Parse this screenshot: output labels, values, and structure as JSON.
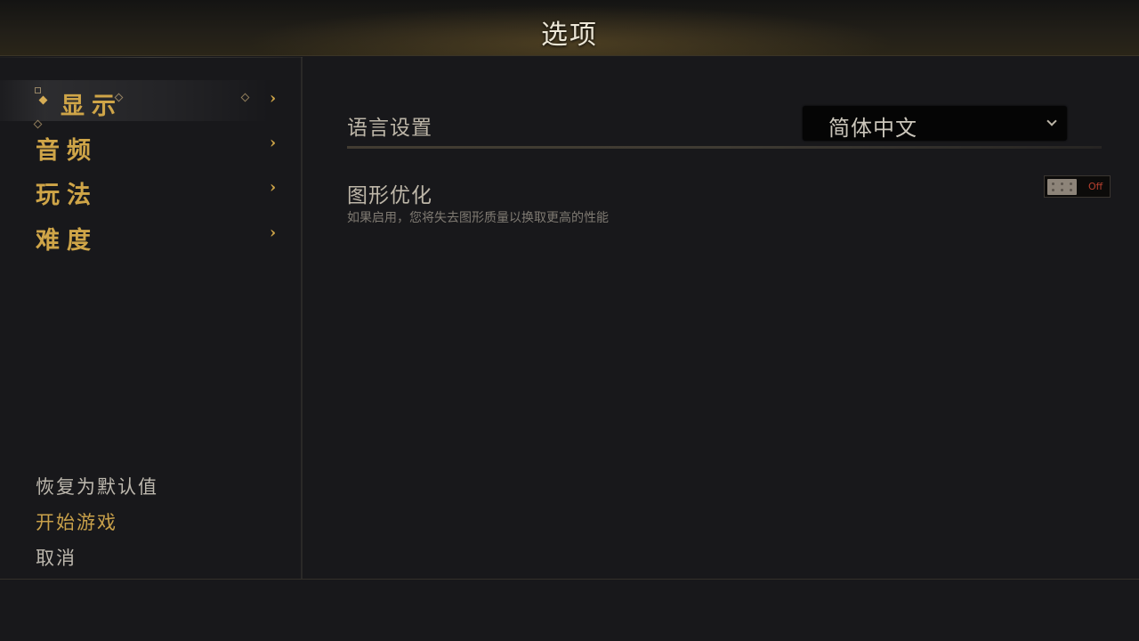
{
  "header": {
    "title": "选项"
  },
  "sidebar": {
    "items": [
      {
        "label": "显示",
        "active": true
      },
      {
        "label": "音频",
        "active": false
      },
      {
        "label": "玩法",
        "active": false
      },
      {
        "label": "难度",
        "active": false
      }
    ],
    "chevron": "›",
    "footer": {
      "reset_label": "恢复为默认值",
      "start_label": "开始游戏",
      "cancel_label": "取消"
    }
  },
  "settings": {
    "language": {
      "label": "语言设置",
      "value": "简体中文"
    },
    "graphics": {
      "label": "图形优化",
      "description": "如果启用，您将失去图形质量以换取更高的性能",
      "toggle_text": "Off"
    }
  },
  "colors": {
    "accent_gold": "#cfa548",
    "background": "#18181b",
    "toggle_off": "#b8402f"
  },
  "icons": [
    "chevron-right-icon",
    "chevron-down-icon",
    "diamond-bullet-icon"
  ]
}
